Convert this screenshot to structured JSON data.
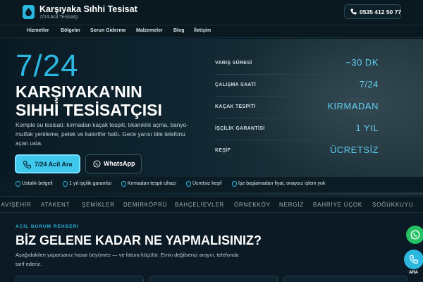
{
  "brand": {
    "title": "Karşıyaka Sıhhi Tesisat",
    "subtitle": "7/24 Acil Tesisatçı",
    "phone": "0535 412 50 77"
  },
  "nav": {
    "items": [
      "Hizmetler",
      "Bölgeler",
      "Sorun Giderme",
      "Malzemeler",
      "Blog",
      "İletişim"
    ]
  },
  "hero": {
    "big": "7/24",
    "headline_line1": "KARŞIYAKA'NIN",
    "headline_line2": "SIHHİ TESİSATÇISI",
    "description": "Komple su tesisatı: kırmadan kaçak tespiti, tıkanıklık açma, banyo-mutfak yenileme, petek ve kalorifer hattı. Gece yarısı bile telefonu açan usta.",
    "cta_primary": "7/24 Acil Ara",
    "cta_whatsapp": "WhatsApp"
  },
  "stats": [
    {
      "label": "VARIŞ SÜRESİ",
      "value": "~30 DK"
    },
    {
      "label": "ÇALIŞMA SAATİ",
      "value": "7/24"
    },
    {
      "label": "KAÇAK TESPİTİ",
      "value": "KIRMADAN"
    },
    {
      "label": "İŞÇİLİK GARANTİSİ",
      "value": "1 YIL"
    },
    {
      "label": "KEŞİF",
      "value": "ÜCRETSİZ"
    }
  ],
  "badges": [
    "Ustalık belgeli",
    "1 yıl işçilik garantisi",
    "Kırmadan tespit cihazı",
    "Ücretsiz keşif",
    "İşe başlamadan fiyat, onaysız işlem yok"
  ],
  "districts": [
    "MAVİŞEHİR",
    "ATAKENT",
    "ŞEMİKLER",
    "DEMİRKÖPRÜ",
    "BAHÇELİEVLER",
    "ÖRNEKKÖY",
    "NERGİZ",
    "BAHRİYE ÜÇOK",
    "SOĞUKKUYU"
  ],
  "emergency": {
    "eyebrow": "ACİL DURUM REHBERİ",
    "title": "BİZ GELENE KADAR NE YAPMALISINIZ?",
    "description": "Aşağıdakileri yaparsanız hasar büyümez — ve fatura küçülür. Emin değilseniz arayın, telefonda tarif ederiz."
  },
  "floating": {
    "call_label": "ARA"
  },
  "colors": {
    "accent": "#2bb7e0",
    "background": "#0b1a24",
    "whatsapp": "#25c265"
  }
}
